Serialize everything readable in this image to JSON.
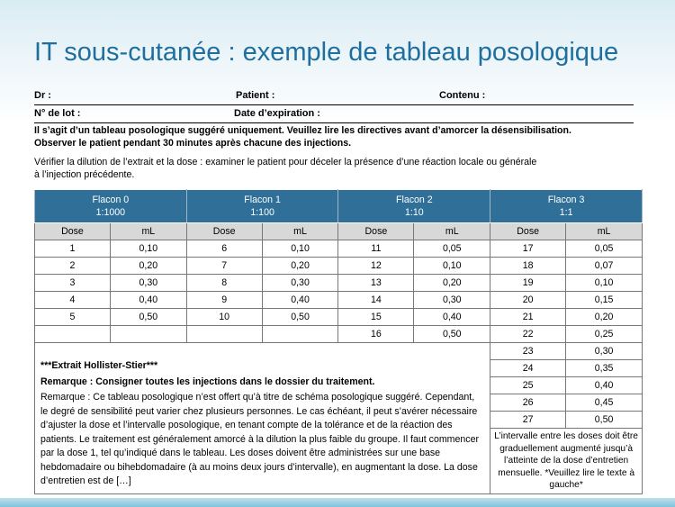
{
  "title": "IT sous-cutanée : exemple de tableau posologique",
  "form": {
    "dr_label": "Dr :",
    "patient_label": "Patient :",
    "contenu_label": "Contenu :",
    "lot_label": "N° de lot :",
    "expiration_label": "Date d’expiration :"
  },
  "warning": {
    "line1": "Il s’agit d’un tableau posologique suggéré uniquement. Veuillez lire les directives avant d’amorcer la désensibilisation.",
    "line2": "Observer le patient pendant 30 minutes après chacune des injections."
  },
  "note": {
    "line1": "Vérifier la dilution de l’extrait et la dose : examiner le patient pour déceler la présence d’une réaction locale ou générale",
    "line2": "à l’injection précédente."
  },
  "table": {
    "vials": [
      {
        "name": "Flacon 0",
        "dilution": "1:1000"
      },
      {
        "name": "Flacon 1",
        "dilution": "1:100"
      },
      {
        "name": "Flacon 2",
        "dilution": "1:10"
      },
      {
        "name": "Flacon 3",
        "dilution": "1:1"
      }
    ],
    "dose_label": "Dose",
    "ml_label": "mL",
    "rows": [
      [
        "1",
        "0,10",
        "6",
        "0,10",
        "11",
        "0,05",
        "17",
        "0,05"
      ],
      [
        "2",
        "0,20",
        "7",
        "0,20",
        "12",
        "0,10",
        "18",
        "0,07"
      ],
      [
        "3",
        "0,30",
        "8",
        "0,30",
        "13",
        "0,20",
        "19",
        "0,10"
      ],
      [
        "4",
        "0,40",
        "9",
        "0,40",
        "14",
        "0,30",
        "20",
        "0,15"
      ],
      [
        "5",
        "0,50",
        "10",
        "0,50",
        "15",
        "0,40",
        "21",
        "0,20"
      ],
      [
        "",
        "",
        "",
        "",
        "16",
        "0,50",
        "22",
        "0,25"
      ]
    ],
    "extra_rows": [
      [
        "23",
        "0,30"
      ],
      [
        "24",
        "0,35"
      ],
      [
        "25",
        "0,40"
      ],
      [
        "26",
        "0,45"
      ],
      [
        "27",
        "0,50"
      ]
    ],
    "extract_title": "***Extrait Hollister-Stier***",
    "remark_bold": "Remarque : Consigner toutes les injections dans le dossier du traitement.",
    "remark_text": "Remarque : Ce tableau posologique n’est offert qu’à titre de schéma posologique suggéré. Cependant, le degré de sensibilité peut varier chez plusieurs personnes. Le cas échéant, il peut s’avérer nécessaire d’ajuster la dose et l’intervalle posologique, en tenant compte de la tolérance et de la réaction des patients. Le traitement est généralement amorcé à la dilution la plus faible du groupe. Il faut commencer par la dose 1, tel qu’indiqué dans le tableau. Les doses doivent être administrées sur une base hebdomadaire ou bihebdomadaire (à au moins deux jours d’intervalle), en augmentant la dose. La dose d’entretien est de […]",
    "interval_note": "L’intervalle entre les doses doit être graduellement augmenté jusqu’à l’atteinte de la dose d’entretien mensuelle. *Veuillez lire le texte à gauche*"
  }
}
